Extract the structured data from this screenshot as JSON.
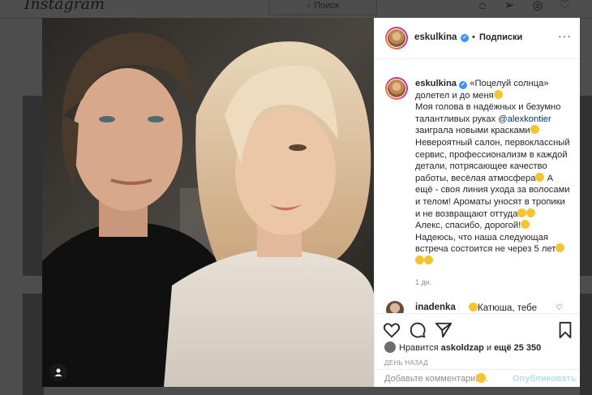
{
  "app": {
    "logo": "Instagram",
    "search_placeholder": "Поиск"
  },
  "post": {
    "username": "eskulkina",
    "dot": "•",
    "follow_label": "Подписки",
    "more": "···",
    "caption": {
      "line1_before": "«Поцелуй солнца» долетел и до меня",
      "line2": "Моя голова в надёжных и безумно талантливых руках ",
      "mention": "@alexkontier",
      "line3": " заиграла новыми красками",
      "line4": "Невероятный салон, первоклассный сервис, профессионализм в каждой детали, потрясающее качество работы, весёлая атмосфера",
      "line5": " А ещё - своя линия ухода за волосами и телом! Ароматы уносят в тропики и не возвращают оттуда",
      "line6": "Алекс, спасибо, дорогой!",
      "line7": "Надеюсь, что наша следующая встреча состоится не через 5 лет"
    },
    "time": "1 дн.",
    "comment": {
      "username": "inadenka",
      "text": "Катюша, тебе"
    },
    "likes": {
      "prefix": "Нравится ",
      "user": "askoldzap",
      "middle": " и ",
      "rest": "ещё 25 350"
    },
    "ago": "ДЕНЬ НАЗАД",
    "comment_placeholder": "Добавьте комментарий...",
    "publish_label": "Опубликовать"
  },
  "colors": {
    "accent": "#3897f0",
    "publish_disabled": "#b2dffc",
    "mention": "#00376b"
  },
  "icons": [
    "heart-icon",
    "comment-icon",
    "share-icon",
    "bookmark-icon",
    "user-tag-icon",
    "more-icon",
    "verified-icon",
    "home-icon",
    "direct-icon",
    "explore-icon",
    "activity-icon"
  ]
}
